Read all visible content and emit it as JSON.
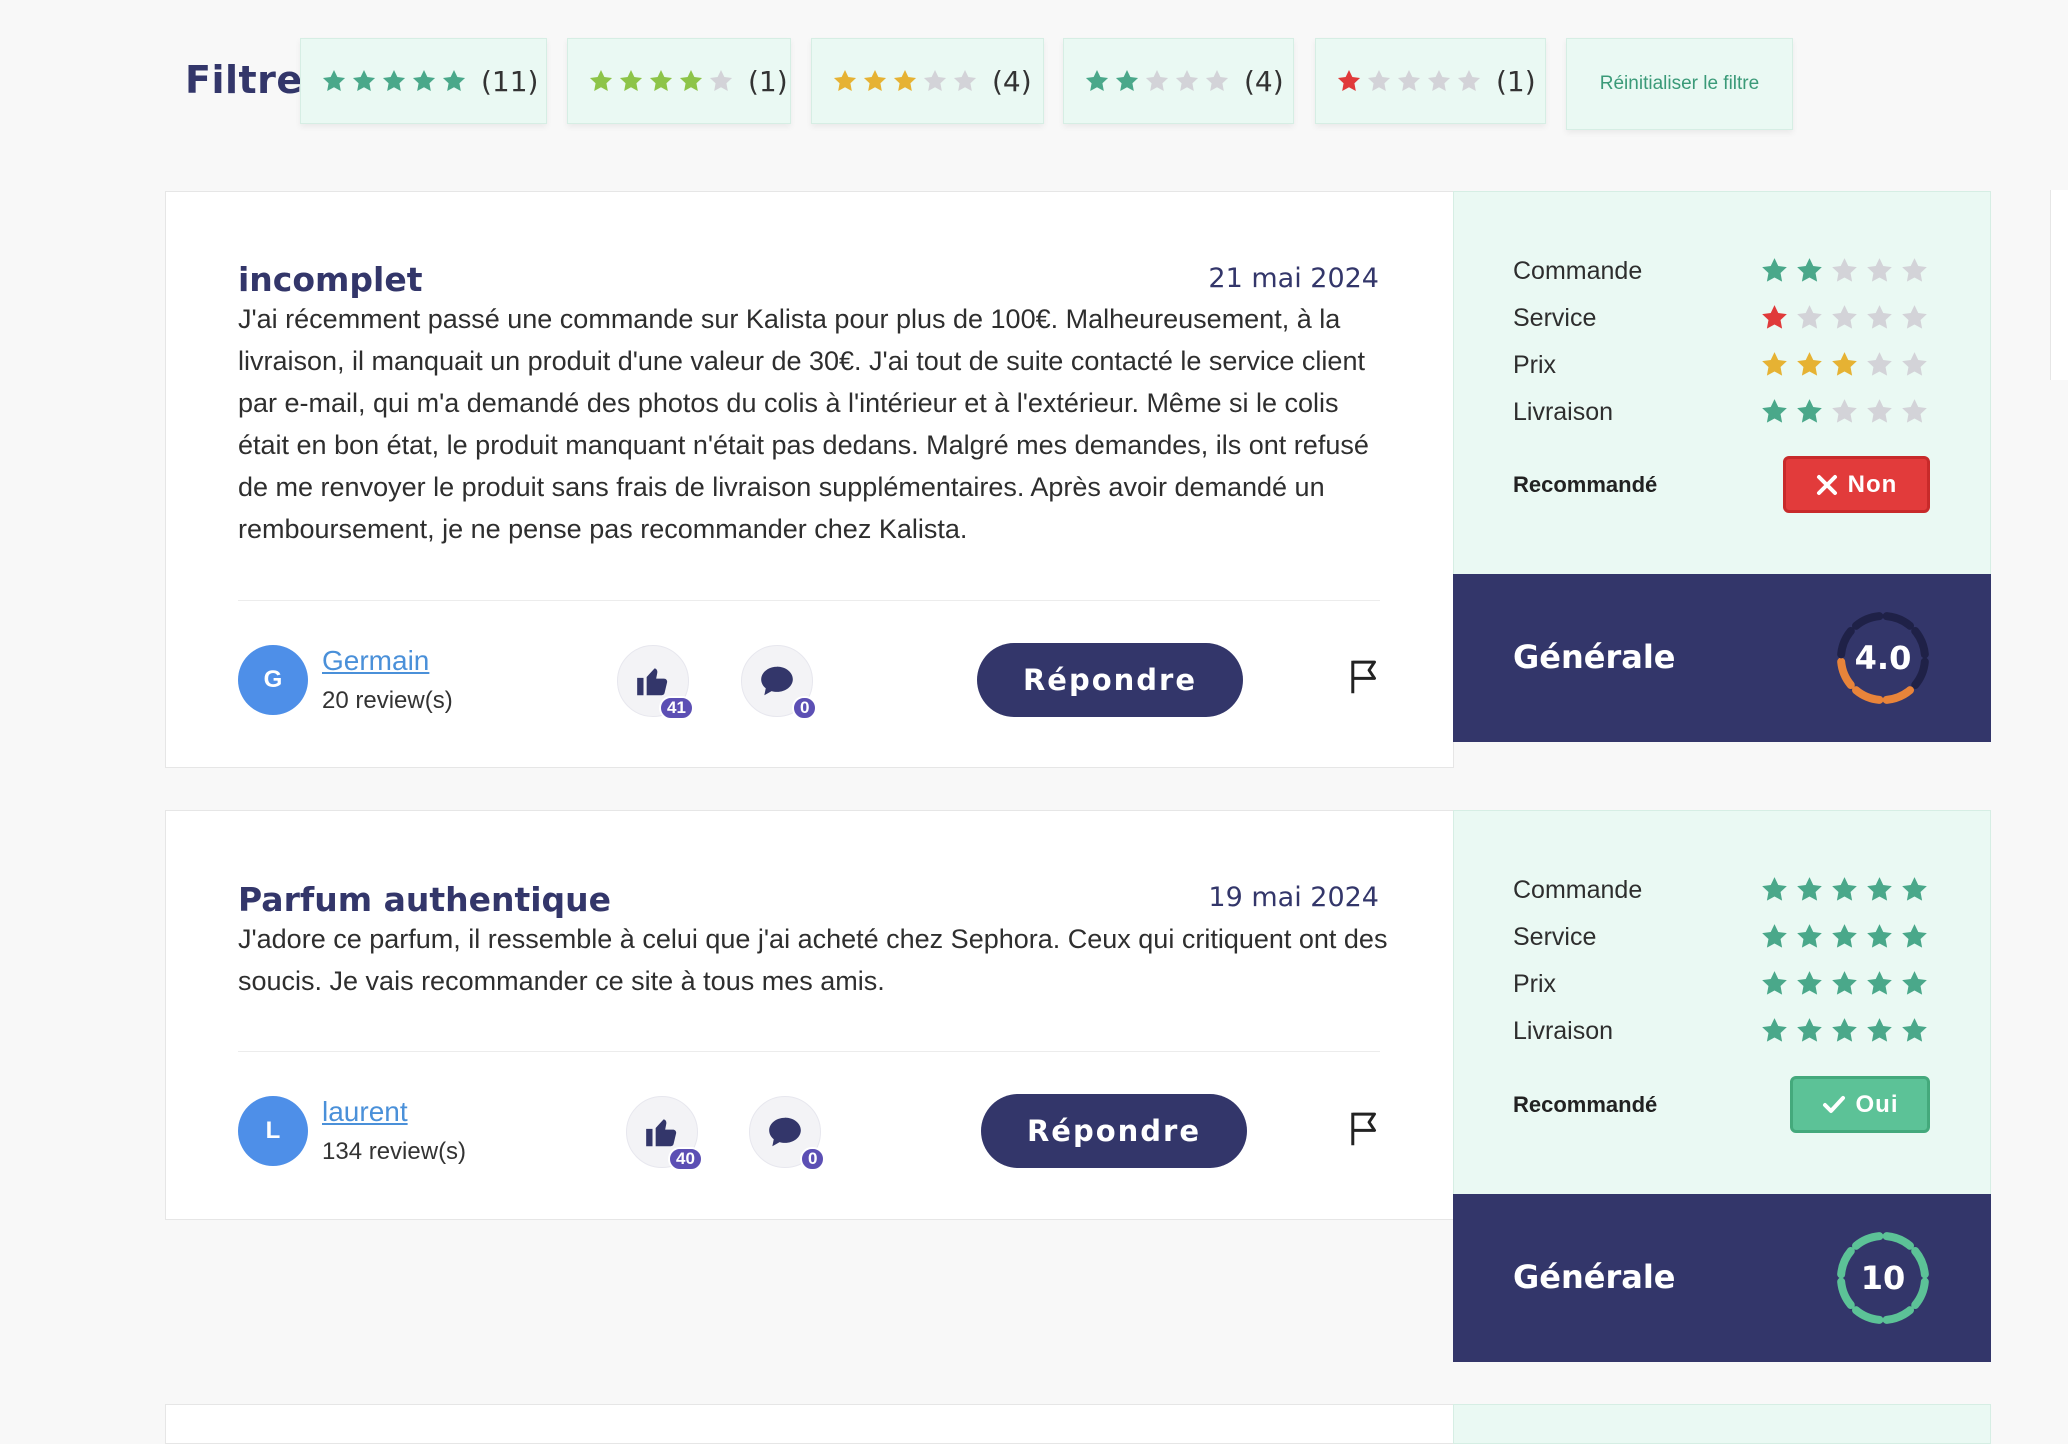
{
  "filter": {
    "label": "Filtre",
    "chips": [
      {
        "stars": 5,
        "color": "#4aa88a",
        "count": "(11)"
      },
      {
        "stars": 4,
        "color": "#8dc449",
        "count": "(1)"
      },
      {
        "stars": 3,
        "color": "#e6b233",
        "count": "(4)"
      },
      {
        "stars": 2,
        "color": "#4aa88a",
        "count": "(4)"
      },
      {
        "stars": 1,
        "color": "#e03a3a",
        "count": "(1)"
      }
    ],
    "reset_label": "Réinitialiser le filtre"
  },
  "colors": {
    "navy": "#33366a",
    "star_empty": "#d3d3d8",
    "star_green": "#4aa88a",
    "star_red": "#e03a3a",
    "star_yellow": "#e6b233",
    "ring_orange": "#e8843a",
    "ring_green": "#5cc297"
  },
  "reviews": [
    {
      "title": "incomplet",
      "date": "21 mai 2024",
      "body": "J'ai récemment passé une commande sur Kalista pour plus de 100€. Malheureusement, à la livraison, il manquait un produit d'une valeur de 30€. J'ai tout de suite contacté le service client par e-mail, qui m'a demandé des photos du colis à l'intérieur et à l'extérieur. Même si le colis était en bon état, le produit manquant n'était pas dedans. Malgré mes demandes, ils ont refusé de me renvoyer le produit sans frais de livraison supplémentaires. Après avoir demandé un remboursement, je ne pense pas recommander chez Kalista.",
      "avatar_initial": "G",
      "author": "Germain",
      "review_count": "20 review(s)",
      "likes": "41",
      "comments": "0",
      "reply_label": "Répondre",
      "ratings": [
        {
          "label": "Commande",
          "stars": 2,
          "color": "#4aa88a"
        },
        {
          "label": "Service",
          "stars": 1,
          "color": "#e03a3a"
        },
        {
          "label": "Prix",
          "stars": 3,
          "color": "#e6b233"
        },
        {
          "label": "Livraison",
          "stars": 2,
          "color": "#4aa88a"
        }
      ],
      "recommended_label": "Recommandé",
      "recommended_value": "Non",
      "recommended": false,
      "general_label": "Générale",
      "general_score": "4.0",
      "score_fraction": 0.4,
      "ring_color": "#e8843a"
    },
    {
      "title": "Parfum authentique",
      "date": "19 mai 2024",
      "body": "J'adore ce parfum, il ressemble à celui que j'ai acheté chez Sephora. Ceux qui critiquent ont des soucis. Je vais recommander ce site à tous mes amis.",
      "avatar_initial": "L",
      "author": "laurent",
      "review_count": "134 review(s)",
      "likes": "40",
      "comments": "0",
      "reply_label": "Répondre",
      "ratings": [
        {
          "label": "Commande",
          "stars": 5,
          "color": "#4aa88a"
        },
        {
          "label": "Service",
          "stars": 5,
          "color": "#4aa88a"
        },
        {
          "label": "Prix",
          "stars": 5,
          "color": "#4aa88a"
        },
        {
          "label": "Livraison",
          "stars": 5,
          "color": "#4aa88a"
        }
      ],
      "recommended_label": "Recommandé",
      "recommended_value": "Oui",
      "recommended": true,
      "general_label": "Générale",
      "general_score": "10",
      "score_fraction": 1.0,
      "ring_color": "#5cc297"
    }
  ]
}
